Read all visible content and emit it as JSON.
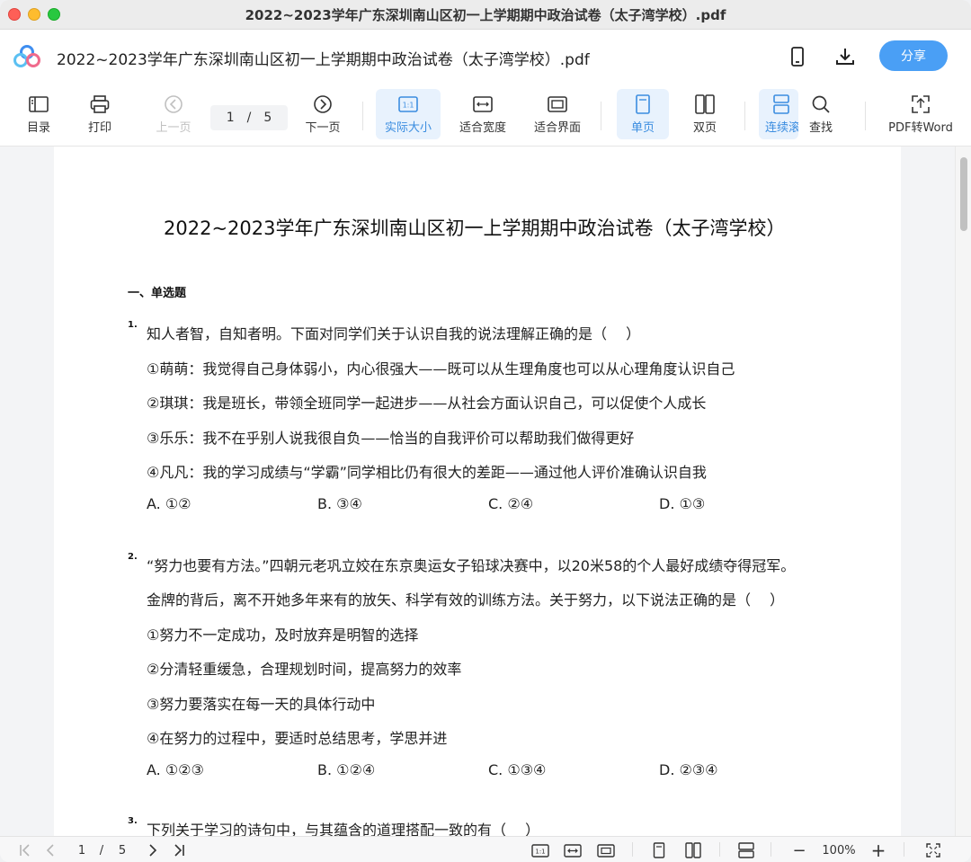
{
  "window": {
    "title": "2022~2023学年广东深圳南山区初一上学期期中政治试卷（太子湾学校）.pdf"
  },
  "header": {
    "doc_title": "2022~2023学年广东深圳南山区初一上学期期中政治试卷（太子湾学校）.pdf",
    "share_label": "分享",
    "accent": "#4a9ff5"
  },
  "toolbar": {
    "toc": "目录",
    "print": "打印",
    "prev": "上一页",
    "page_current": "1",
    "page_sep": "/",
    "page_total": "5",
    "next": "下一页",
    "actual_size": "实际大小",
    "fit_width": "适合宽度",
    "fit_page": "适合界面",
    "single": "单页",
    "double": "双页",
    "continuous": "连续滚",
    "search": "查找",
    "to_word": "PDF转Word"
  },
  "document": {
    "title": "2022~2023学年广东深圳南山区初一上学期期中政治试卷（太子湾学校）",
    "section": "一、单选题",
    "questions": [
      {
        "num": "1.",
        "lines": [
          "知人者智，自知者明。下面对同学们关于认识自我的说法理解正确的是（　 ）",
          "①萌萌：我觉得自己身体弱小，内心很强大——既可以从生理角度也可以从心理角度认识自己",
          "②琪琪：我是班长，带领全班同学一起进步——从社会方面认识自己，可以促使个人成长",
          "③乐乐：我不在乎别人说我很自负——恰当的自我评价可以帮助我们做得更好",
          "④凡凡：我的学习成绩与“学霸”同学相比仍有很大的差距——通过他人评价准确认识自我"
        ],
        "options": [
          "A. ①②",
          "B. ③④",
          "C. ②④",
          "D. ①③"
        ]
      },
      {
        "num": "2.",
        "lines": [
          "“努力也要有方法。”四朝元老巩立姣在东京奥运女子铅球决赛中，以20米58的个人最好成绩夺得冠军。",
          "金牌的背后，离不开她多年来有的放矢、科学有效的训练方法。关于努力，以下说法正确的是（　 ）",
          "①努力不一定成功，及时放弃是明智的选择",
          "②分清轻重缓急，合理规划时间，提高努力的效率",
          "③努力要落实在每一天的具体行动中",
          "④在努力的过程中，要适时总结思考，学思并进"
        ],
        "options": [
          "A. ①②③",
          "B. ①②④",
          "C. ①③④",
          "D. ②③④"
        ]
      },
      {
        "num": "3.",
        "lines": [
          "下列关于学习的诗句中，与其蕴含的道理搭配一致的有（　 ）"
        ],
        "options": []
      }
    ]
  },
  "statusbar": {
    "page_current": "1",
    "page_sep": "/",
    "page_total": "5",
    "zoom": "100%",
    "minus": "−",
    "plus": "+"
  }
}
